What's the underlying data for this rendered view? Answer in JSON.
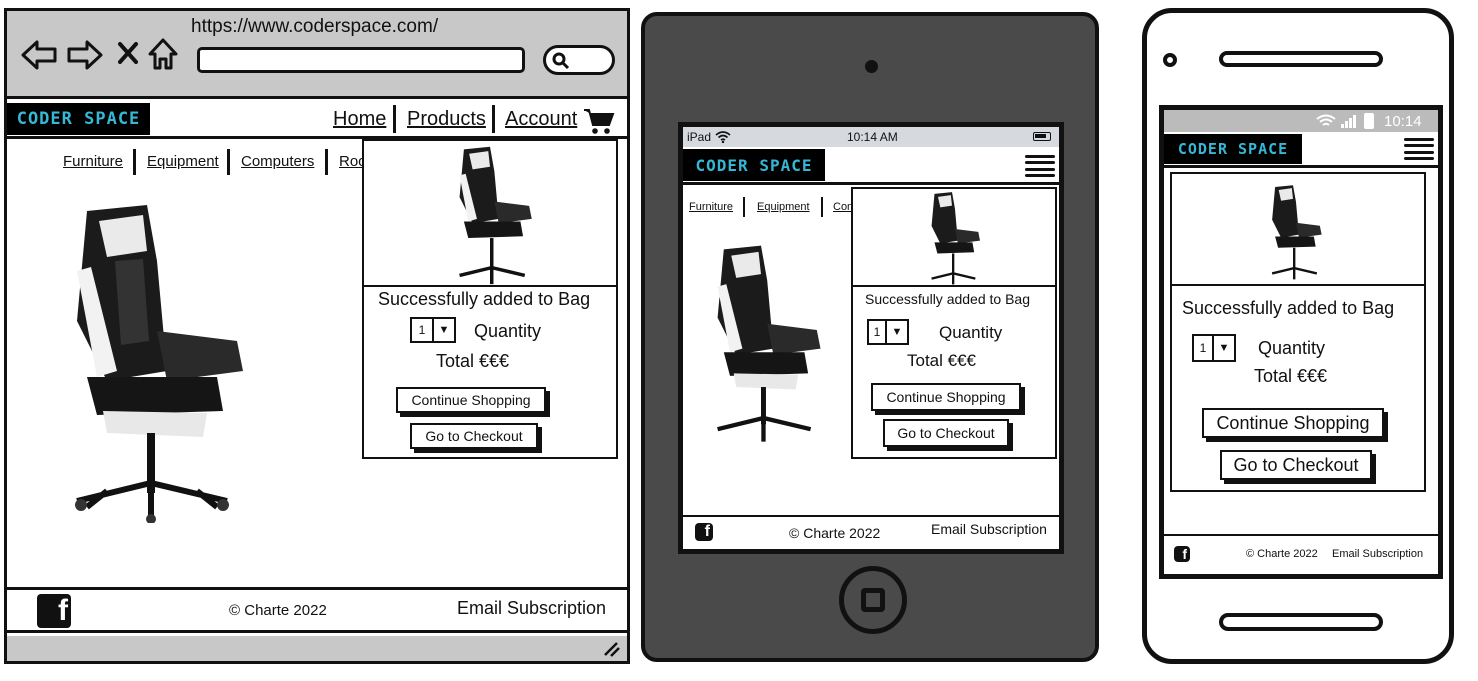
{
  "desktop": {
    "url": "https://www.coderspace.com/",
    "logo": "CODER SPACE",
    "nav": [
      "Home",
      "Products",
      "Account"
    ],
    "categories": [
      "Furniture",
      "Equipment",
      "Computers",
      "Roo"
    ],
    "popup": {
      "message": "Successfully added to Bag",
      "qty_value": "1",
      "qty_label": "Quantity",
      "total": "Total €€€",
      "continue": "Continue Shopping",
      "checkout": "Go to Checkout"
    },
    "footer": {
      "facebook": "f",
      "copyright": "Charte 2022",
      "subscription": "Email Subscription"
    }
  },
  "tablet": {
    "status": {
      "device": "iPad",
      "time": "10:14 AM"
    },
    "logo": "CODER SPACE",
    "categories": [
      "Furniture",
      "Equipment",
      "Com"
    ],
    "popup": {
      "message": "Successfully added to Bag",
      "qty_value": "1",
      "qty_label": "Quantity",
      "total": "Total €€€",
      "continue": "Continue Shopping",
      "checkout": "Go to Checkout"
    },
    "footer": {
      "facebook": "f",
      "copyright": "Charte 2022",
      "subscription": "Email Subscription"
    }
  },
  "phone": {
    "status": {
      "time": "10:14"
    },
    "logo": "CODER SPACE",
    "popup": {
      "message": "Successfully added to Bag",
      "qty_value": "1",
      "qty_label": "Quantity",
      "total": "Total €€€",
      "continue": "Continue Shopping",
      "checkout": "Go to Checkout"
    },
    "footer": {
      "facebook": "f",
      "copyright": "Charte 2022",
      "subscription": "Email Subscription"
    }
  }
}
